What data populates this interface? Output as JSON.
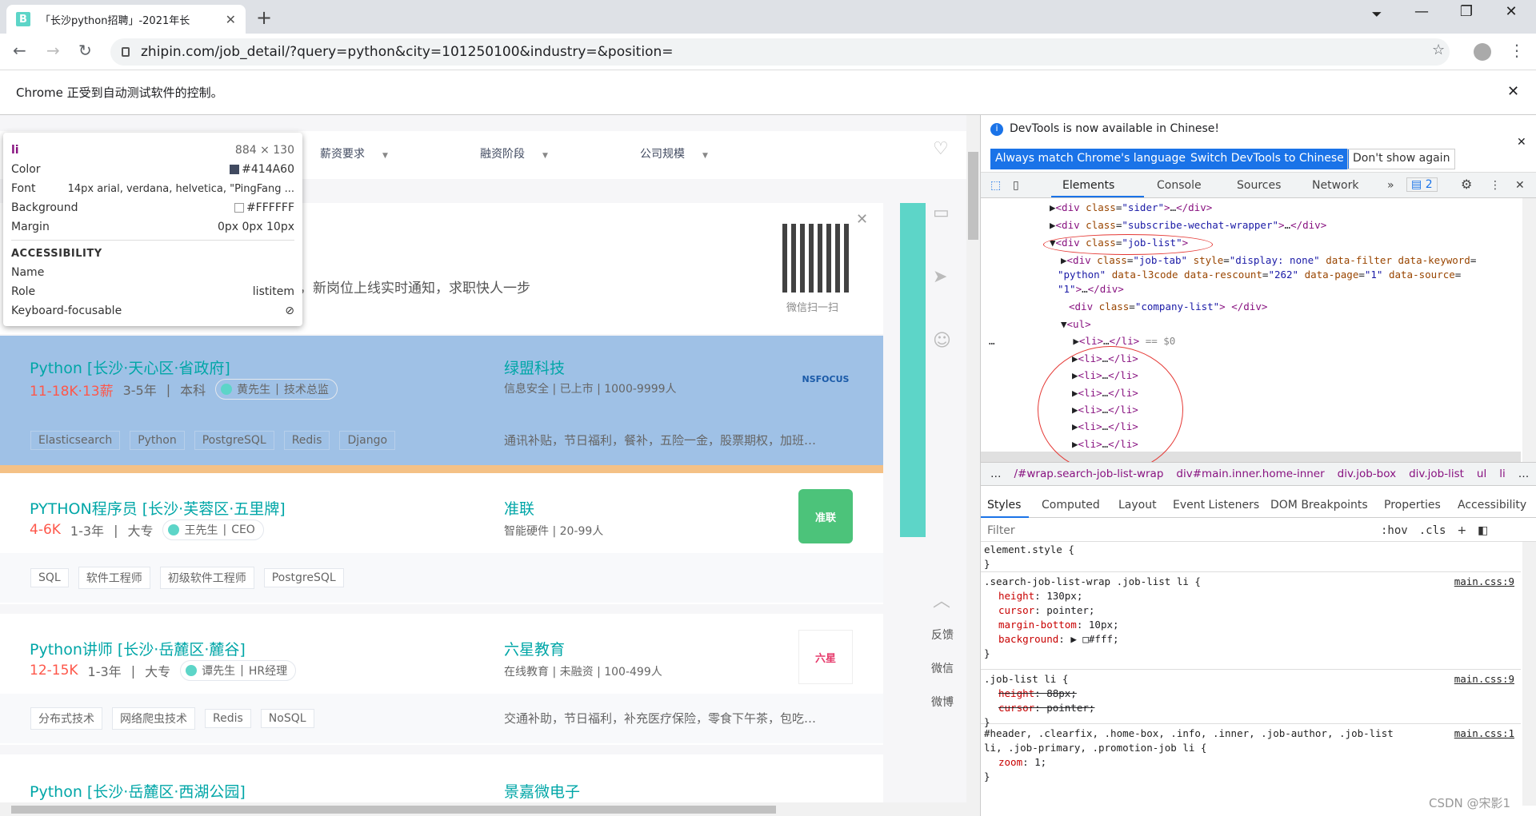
{
  "browser": {
    "tab_title": "「长沙python招聘」-2021年长",
    "favicon": "B",
    "url": "zhipin.com/job_detail/?query=python&city=101250100&industry=&position=",
    "infobar": "Chrome 正受到自动测试软件的控制。"
  },
  "filters": {
    "salary": "薪资要求",
    "funding": "融资阶段",
    "scale": "公司规模"
  },
  "banner": {
    "text": "，新岗位上线实时通知，求职快人一步",
    "qr_caption": "微信扫一扫"
  },
  "tooltip": {
    "tag": "li",
    "size": "884 × 130",
    "color_label": "Color",
    "color": "#414A60",
    "font_label": "Font",
    "font": "14px arial, verdana, helvetica, \"PingFang ...",
    "bg_label": "Background",
    "bg": "#FFFFFF",
    "margin_label": "Margin",
    "margin": "0px 0px 10px",
    "a11y": "ACCESSIBILITY",
    "name_label": "Name",
    "role_label": "Role",
    "role": "listitem",
    "kf_label": "Keyboard-focusable"
  },
  "jobs": [
    {
      "title": "Python  [长沙·天心区·省政府]",
      "salary": "11-18K·13薪",
      "exp": "3-5年",
      "edu": "本科",
      "hr": "黄先生",
      "hr_title": "技术总监",
      "company": "绿盟科技",
      "cmeta": "信息安全   |   已上市   |   1000-9999人",
      "tags": [
        "Elasticsearch",
        "Python",
        "PostgreSQL",
        "Redis",
        "Django"
      ],
      "welfare": "通讯补贴，节日福利，餐补，五险一金，股票期权，加班…",
      "logo": "NSFOCUS"
    },
    {
      "title": "PYTHON程序员  [长沙·芙蓉区·五里牌]",
      "salary": "4-6K",
      "exp": "1-3年",
      "edu": "大专",
      "hr": "王先生",
      "hr_title": "CEO",
      "company": "准联",
      "cmeta": "智能硬件   |   20-99人",
      "tags": [
        "SQL",
        "软件工程师",
        "初级软件工程师",
        "PostgreSQL"
      ],
      "welfare": "",
      "logo": "准联"
    },
    {
      "title": "Python讲师  [长沙·岳麓区·麓谷]",
      "salary": "12-15K",
      "exp": "1-3年",
      "edu": "大专",
      "hr": "谭先生",
      "hr_title": "HR经理",
      "company": "六星教育",
      "cmeta": "在线教育   |   未融资   |   100-499人",
      "tags": [
        "分布式技术",
        "网络爬虫技术",
        "Redis",
        "NoSQL"
      ],
      "welfare": "交通补助，节日福利，补充医疗保险，零食下午茶，包吃…",
      "logo": "六星"
    },
    {
      "title": "Python  [长沙·岳麓区·西湖公园]",
      "company": "景嘉微电子"
    }
  ],
  "side": {
    "feedback": "反馈",
    "wechat": "微信",
    "weibo": "微博"
  },
  "devtools": {
    "notice": "DevTools is now available in Chinese!",
    "btn1": "Always match Chrome's language",
    "btn2": "Switch DevTools to Chinese",
    "btn3": "Don't show again",
    "tabs": [
      "Elements",
      "Console",
      "Sources",
      "Network"
    ],
    "badge": "2",
    "crumbs": [
      "…",
      "/#wrap.search-job-list-wrap",
      "div#main.inner.home-inner",
      "div.job-box",
      "div.job-list",
      "ul",
      "li",
      "…"
    ],
    "subtabs": [
      "Styles",
      "Computed",
      "Layout",
      "Event Listeners",
      "DOM Breakpoints",
      "Properties",
      "Accessibility"
    ],
    "filter": "Filter",
    "hov": ":hov",
    ".cls": ".cls",
    "css": {
      "element": "element.style {",
      "close": "}",
      "r1_sel": ".search-job-list-wrap .job-list li {",
      "r1_src": "main.css:9",
      "r2_sel": ".job-list li {",
      "r2_src": "main.css:9",
      "r3_sel": "#header, .clearfix, .home-box, .info, .inner, .job-author, .job-list",
      "r3_sel2": "li, .job-primary, .promotion-job li {",
      "r3_src": "main.css:1"
    }
  },
  "watermark": "CSDN @宋影1"
}
